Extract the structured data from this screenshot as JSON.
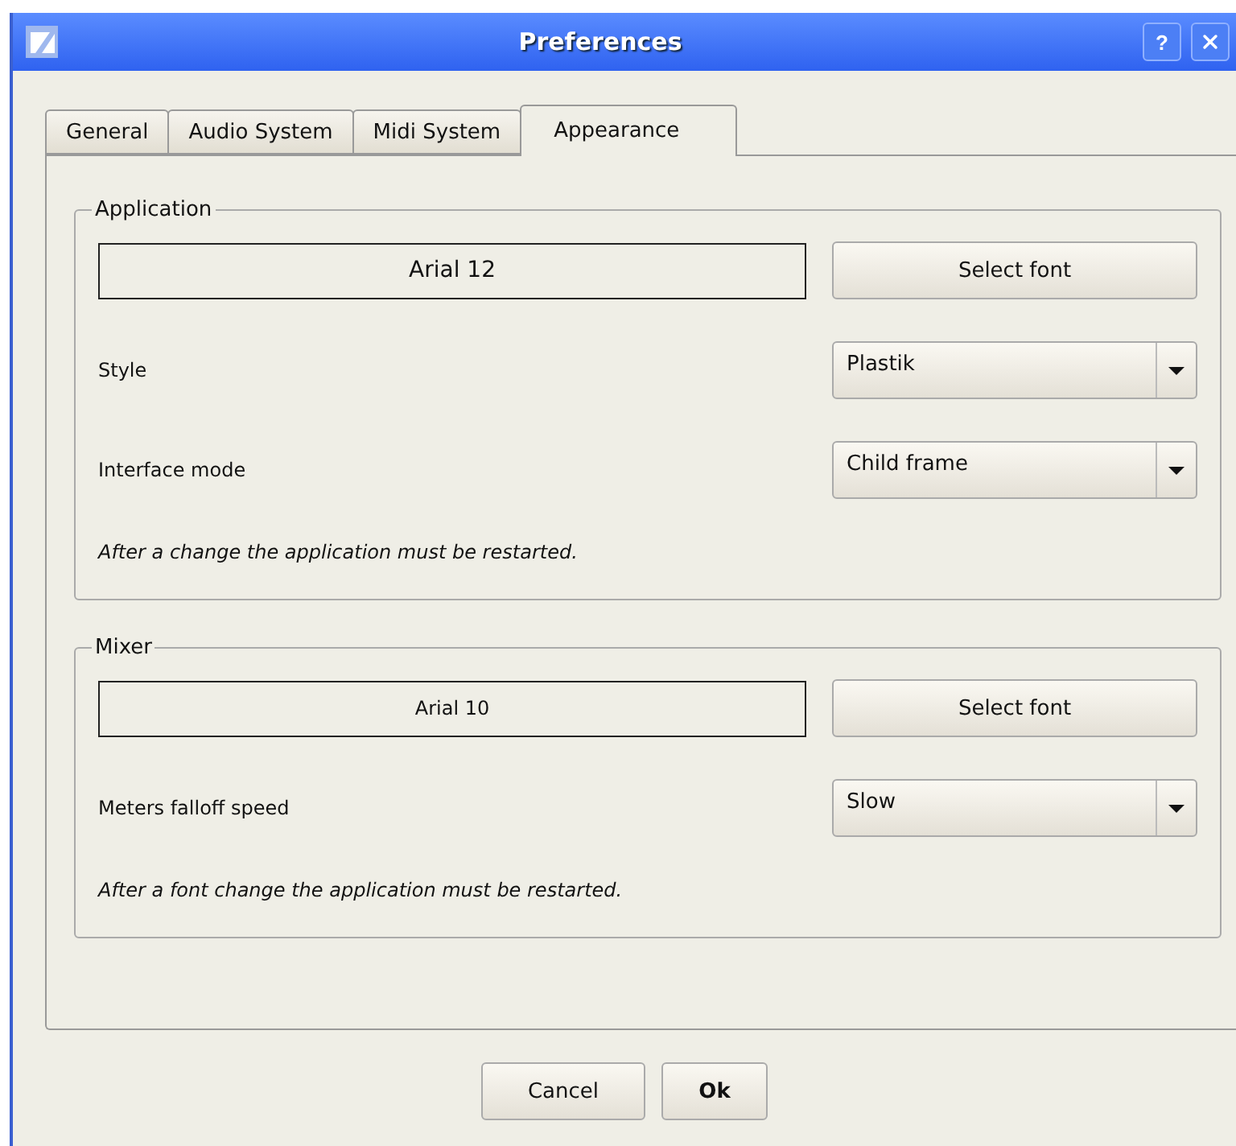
{
  "window": {
    "title": "Preferences",
    "help_button": "?"
  },
  "tabs": [
    {
      "label": "General",
      "selected": false
    },
    {
      "label": "Audio System",
      "selected": false
    },
    {
      "label": "Midi System",
      "selected": false
    },
    {
      "label": "Appearance",
      "selected": true
    }
  ],
  "groups": [
    {
      "title": "Application",
      "rows": [
        {
          "kind": "font",
          "value": "Arial  12",
          "button": "Select font"
        },
        {
          "kind": "select",
          "label": "Style",
          "value": "Plastik"
        },
        {
          "kind": "select",
          "label": "Interface mode",
          "value": "Child frame"
        },
        {
          "kind": "note",
          "text": "After a change the application must be restarted."
        }
      ]
    },
    {
      "title": "Mixer",
      "rows": [
        {
          "kind": "font",
          "value": "Arial  10",
          "button": "Select font"
        },
        {
          "kind": "select",
          "label": "Meters falloff speed",
          "value": "Slow"
        },
        {
          "kind": "note",
          "text": "After a font change the application must be restarted."
        }
      ]
    }
  ],
  "buttons": [
    {
      "label": "Cancel",
      "default": false
    },
    {
      "label": "Ok",
      "default": true
    }
  ]
}
